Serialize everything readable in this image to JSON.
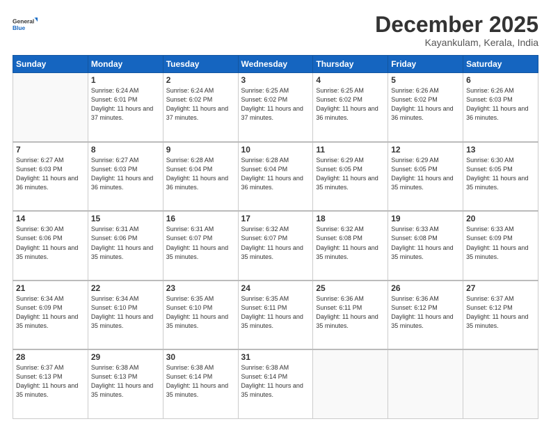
{
  "header": {
    "logo_line1": "General",
    "logo_line2": "Blue",
    "month": "December 2025",
    "location": "Kayankulam, Kerala, India"
  },
  "weekdays": [
    "Sunday",
    "Monday",
    "Tuesday",
    "Wednesday",
    "Thursday",
    "Friday",
    "Saturday"
  ],
  "weeks": [
    [
      {
        "day": "",
        "info": ""
      },
      {
        "day": "1",
        "info": "Sunrise: 6:24 AM\nSunset: 6:01 PM\nDaylight: 11 hours\nand 37 minutes."
      },
      {
        "day": "2",
        "info": "Sunrise: 6:24 AM\nSunset: 6:02 PM\nDaylight: 11 hours\nand 37 minutes."
      },
      {
        "day": "3",
        "info": "Sunrise: 6:25 AM\nSunset: 6:02 PM\nDaylight: 11 hours\nand 37 minutes."
      },
      {
        "day": "4",
        "info": "Sunrise: 6:25 AM\nSunset: 6:02 PM\nDaylight: 11 hours\nand 36 minutes."
      },
      {
        "day": "5",
        "info": "Sunrise: 6:26 AM\nSunset: 6:02 PM\nDaylight: 11 hours\nand 36 minutes."
      },
      {
        "day": "6",
        "info": "Sunrise: 6:26 AM\nSunset: 6:03 PM\nDaylight: 11 hours\nand 36 minutes."
      }
    ],
    [
      {
        "day": "7",
        "info": "Sunrise: 6:27 AM\nSunset: 6:03 PM\nDaylight: 11 hours\nand 36 minutes."
      },
      {
        "day": "8",
        "info": "Sunrise: 6:27 AM\nSunset: 6:03 PM\nDaylight: 11 hours\nand 36 minutes."
      },
      {
        "day": "9",
        "info": "Sunrise: 6:28 AM\nSunset: 6:04 PM\nDaylight: 11 hours\nand 36 minutes."
      },
      {
        "day": "10",
        "info": "Sunrise: 6:28 AM\nSunset: 6:04 PM\nDaylight: 11 hours\nand 36 minutes."
      },
      {
        "day": "11",
        "info": "Sunrise: 6:29 AM\nSunset: 6:05 PM\nDaylight: 11 hours\nand 35 minutes."
      },
      {
        "day": "12",
        "info": "Sunrise: 6:29 AM\nSunset: 6:05 PM\nDaylight: 11 hours\nand 35 minutes."
      },
      {
        "day": "13",
        "info": "Sunrise: 6:30 AM\nSunset: 6:05 PM\nDaylight: 11 hours\nand 35 minutes."
      }
    ],
    [
      {
        "day": "14",
        "info": "Sunrise: 6:30 AM\nSunset: 6:06 PM\nDaylight: 11 hours\nand 35 minutes."
      },
      {
        "day": "15",
        "info": "Sunrise: 6:31 AM\nSunset: 6:06 PM\nDaylight: 11 hours\nand 35 minutes."
      },
      {
        "day": "16",
        "info": "Sunrise: 6:31 AM\nSunset: 6:07 PM\nDaylight: 11 hours\nand 35 minutes."
      },
      {
        "day": "17",
        "info": "Sunrise: 6:32 AM\nSunset: 6:07 PM\nDaylight: 11 hours\nand 35 minutes."
      },
      {
        "day": "18",
        "info": "Sunrise: 6:32 AM\nSunset: 6:08 PM\nDaylight: 11 hours\nand 35 minutes."
      },
      {
        "day": "19",
        "info": "Sunrise: 6:33 AM\nSunset: 6:08 PM\nDaylight: 11 hours\nand 35 minutes."
      },
      {
        "day": "20",
        "info": "Sunrise: 6:33 AM\nSunset: 6:09 PM\nDaylight: 11 hours\nand 35 minutes."
      }
    ],
    [
      {
        "day": "21",
        "info": "Sunrise: 6:34 AM\nSunset: 6:09 PM\nDaylight: 11 hours\nand 35 minutes."
      },
      {
        "day": "22",
        "info": "Sunrise: 6:34 AM\nSunset: 6:10 PM\nDaylight: 11 hours\nand 35 minutes."
      },
      {
        "day": "23",
        "info": "Sunrise: 6:35 AM\nSunset: 6:10 PM\nDaylight: 11 hours\nand 35 minutes."
      },
      {
        "day": "24",
        "info": "Sunrise: 6:35 AM\nSunset: 6:11 PM\nDaylight: 11 hours\nand 35 minutes."
      },
      {
        "day": "25",
        "info": "Sunrise: 6:36 AM\nSunset: 6:11 PM\nDaylight: 11 hours\nand 35 minutes."
      },
      {
        "day": "26",
        "info": "Sunrise: 6:36 AM\nSunset: 6:12 PM\nDaylight: 11 hours\nand 35 minutes."
      },
      {
        "day": "27",
        "info": "Sunrise: 6:37 AM\nSunset: 6:12 PM\nDaylight: 11 hours\nand 35 minutes."
      }
    ],
    [
      {
        "day": "28",
        "info": "Sunrise: 6:37 AM\nSunset: 6:13 PM\nDaylight: 11 hours\nand 35 minutes."
      },
      {
        "day": "29",
        "info": "Sunrise: 6:38 AM\nSunset: 6:13 PM\nDaylight: 11 hours\nand 35 minutes."
      },
      {
        "day": "30",
        "info": "Sunrise: 6:38 AM\nSunset: 6:14 PM\nDaylight: 11 hours\nand 35 minutes."
      },
      {
        "day": "31",
        "info": "Sunrise: 6:38 AM\nSunset: 6:14 PM\nDaylight: 11 hours\nand 35 minutes."
      },
      {
        "day": "",
        "info": ""
      },
      {
        "day": "",
        "info": ""
      },
      {
        "day": "",
        "info": ""
      }
    ]
  ]
}
